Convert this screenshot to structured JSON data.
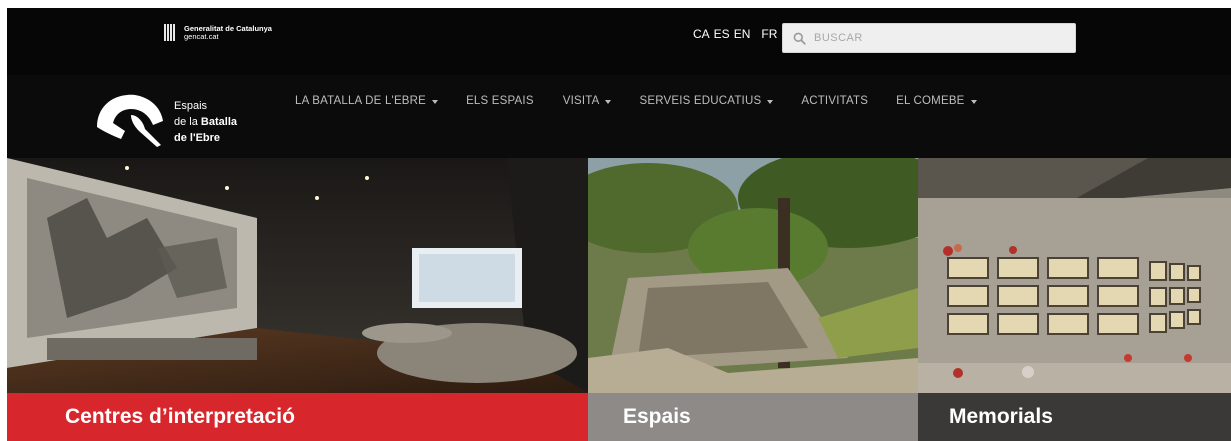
{
  "topbar": {
    "gencat_line1": "Generalitat de Catalunya",
    "gencat_line2": "gencat.cat",
    "languages": [
      "CA",
      "ES",
      "EN",
      "FR"
    ],
    "search_placeholder": "BUSCAR"
  },
  "site": {
    "title_line1": "Espais",
    "title_line2_prefix": "de la",
    "title_line2_bold": "Batalla",
    "title_line3": "de l'Ebre"
  },
  "menu": [
    {
      "label": "LA BATALLA DE L'EBRE",
      "dropdown": true
    },
    {
      "label": "ELS ESPAIS",
      "dropdown": false
    },
    {
      "label": "VISITA",
      "dropdown": true
    },
    {
      "label": "SERVEIS EDUCATIUS",
      "dropdown": true
    },
    {
      "label": "ACTIVITATS",
      "dropdown": false
    },
    {
      "label": "EL COMEBE",
      "dropdown": true
    }
  ],
  "panels": [
    {
      "label": "Centres d’interpretació",
      "color": "#d8272c"
    },
    {
      "label": "Espais",
      "color": "#8e8a88"
    },
    {
      "label": "Memorials",
      "color": "#3a3937"
    }
  ],
  "colors": {
    "topbar": "#060606",
    "navbar": "#0b0b0b",
    "accent": "#d8272c"
  }
}
